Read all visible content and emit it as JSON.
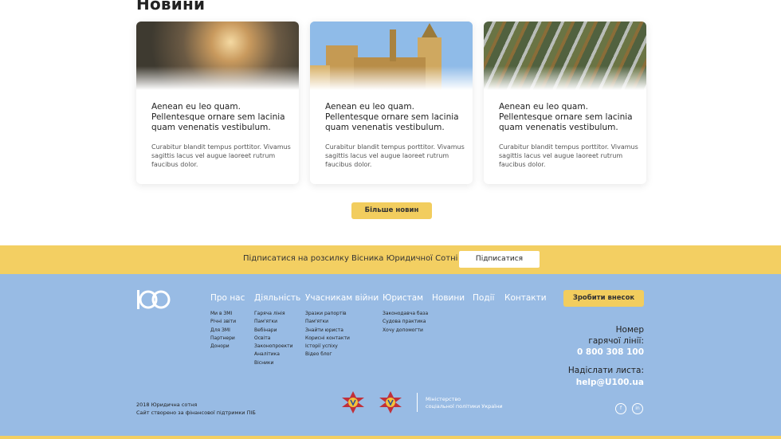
{
  "news": {
    "title": "Новини",
    "cards": [
      {
        "heading": "Aenean eu leo quam. Pellentesque ornare sem lacinia quam venenatis vestibulum.",
        "text": "Curabitur blandit tempus porttitor. Vivamus sagittis lacus vel augue laoreet rutrum faucibus dolor."
      },
      {
        "heading": "Aenean eu leo quam. Pellentesque ornare sem lacinia quam venenatis vestibulum.",
        "text": "Curabitur blandit tempus porttitor. Vivamus sagittis lacus vel augue laoreet rutrum faucibus dolor."
      },
      {
        "heading": "Aenean eu leo quam. Pellentesque ornare sem lacinia quam venenatis vestibulum.",
        "text": "Curabitur blandit tempus porttitor. Vivamus sagittis lacus vel augue laoreet rutrum faucibus dolor."
      }
    ],
    "more_label": "Більше новин"
  },
  "subscribe": {
    "text": "Підписатися на розсилку Вісника Юридичної Сотні",
    "button": "Підписатися"
  },
  "footer": {
    "nav": [
      "Про нас",
      "Діяльність",
      "Учасникам війни",
      "Юристам",
      "Новини",
      "Події",
      "Контакти"
    ],
    "columns": [
      [
        "Ми в ЗМІ",
        "Річні звіти",
        "Для ЗМІ",
        "Партнери",
        "Донори"
      ],
      [
        "Гаряча лінія",
        "Пам'ятки",
        "Вебінари",
        "Освіта",
        "Законопроекти",
        "Аналітика",
        "Вісники"
      ],
      [
        "Зразки рапортів",
        "Пам'ятки",
        "Знайти юриста",
        "Корисні контакти",
        "Історії успіху",
        "Відео блог"
      ],
      [
        "Законодавча база",
        "Судова практика",
        "Хочу допомогти"
      ]
    ],
    "donate": "Зробити внесок",
    "hotline_label_1": "Номер",
    "hotline_label_2": "гарячої лінії:",
    "hotline_number": "0 800 308 100",
    "mail_label": "Надіслати листа:",
    "mail_address": "help@U100.ua",
    "copyright_1": "2018 Юридична сотня",
    "copyright_2": "Сайт створено за фінансової підтримки ПІБ",
    "ministry_1": "Міністерство",
    "ministry_2": "соціальної політики України",
    "social": [
      "f",
      "in"
    ]
  },
  "colors": {
    "accent": "#f2cd5e",
    "footer_bg": "#98bbe4"
  }
}
